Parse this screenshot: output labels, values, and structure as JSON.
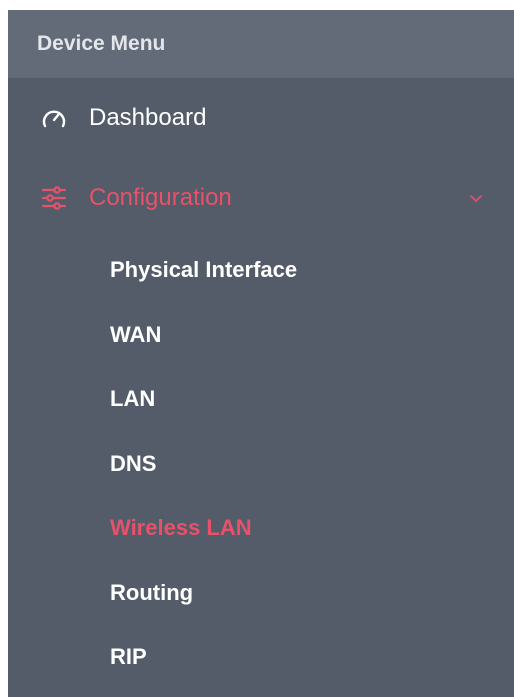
{
  "menu": {
    "header": "Device Menu",
    "dashboard": {
      "label": "Dashboard",
      "icon": "speedometer-icon"
    },
    "configuration": {
      "label": "Configuration",
      "icon": "sliders-icon",
      "expanded": true,
      "items": [
        {
          "label": "Physical Interface",
          "selected": false
        },
        {
          "label": "WAN",
          "selected": false
        },
        {
          "label": "LAN",
          "selected": false
        },
        {
          "label": "DNS",
          "selected": false
        },
        {
          "label": "Wireless LAN",
          "selected": true
        },
        {
          "label": "Routing",
          "selected": false
        },
        {
          "label": "RIP",
          "selected": false
        }
      ]
    }
  },
  "colors": {
    "sidebar_bg": "#535c68",
    "header_bg": "#626b77",
    "accent": "#e8516a",
    "text": "#ffffff"
  }
}
